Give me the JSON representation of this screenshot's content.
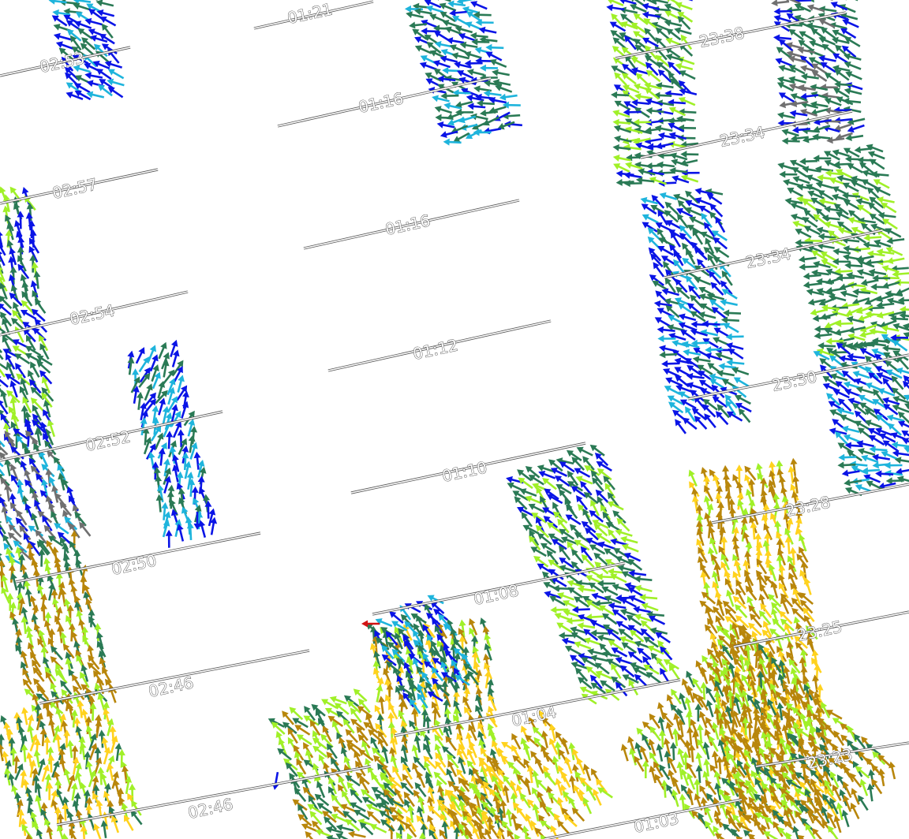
{
  "map": {
    "title": "",
    "colors": {
      "blue": "#0a14e6",
      "cyan": "#1eb4dc",
      "dark_green": "#2a7a55",
      "lime": "#a0f028",
      "gold": "#b8860b",
      "yellow": "#ffd21e",
      "orange": "#f08c14",
      "gray": "#707070",
      "red": "#d21414",
      "track": "#555555",
      "background": "#ffffff"
    },
    "tracks": [
      {
        "label": "02:53",
        "color_hint": "gray"
      },
      {
        "label": "02:57",
        "color_hint": "gray"
      },
      {
        "label": "02:54",
        "color_hint": "gray"
      },
      {
        "label": "02:52",
        "color_hint": "gray"
      },
      {
        "label": "02:50",
        "color_hint": "gray"
      },
      {
        "label": "02:46",
        "color_hint": "gray"
      },
      {
        "label": "02:46",
        "color_hint": "gray"
      },
      {
        "label": "01:21",
        "color_hint": "gray"
      },
      {
        "label": "01:16",
        "color_hint": "gray"
      },
      {
        "label": "01:16",
        "color_hint": "gray"
      },
      {
        "label": "01:12",
        "color_hint": "gray"
      },
      {
        "label": "01:10",
        "color_hint": "gray"
      },
      {
        "label": "01:08",
        "color_hint": "gray"
      },
      {
        "label": "01:04",
        "color_hint": "gray"
      },
      {
        "label": "01:03",
        "color_hint": "gray"
      },
      {
        "label": "23:38",
        "color_hint": "gray"
      },
      {
        "label": "23:34",
        "color_hint": "gray"
      },
      {
        "label": "23:34",
        "color_hint": "gray"
      },
      {
        "label": "23:30",
        "color_hint": "gray"
      },
      {
        "label": "23:28",
        "color_hint": "gray"
      },
      {
        "label": "23:25",
        "color_hint": "gray"
      },
      {
        "label": "23:23",
        "color_hint": "gray"
      }
    ]
  }
}
